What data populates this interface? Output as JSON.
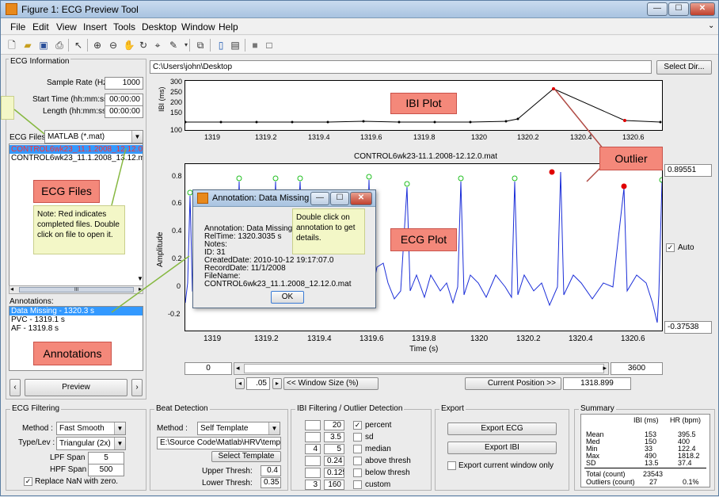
{
  "window": {
    "title": "Figure 1: ECG Preview Tool"
  },
  "menu": [
    "File",
    "Edit",
    "View",
    "Insert",
    "Tools",
    "Desktop",
    "Window",
    "Help"
  ],
  "ecg_info": {
    "title": "ECG Information",
    "sample_rate_label": "Sample Rate (Hz):",
    "sample_rate": "1000",
    "start_time_label": "Start Time (hh:mm:ss):",
    "start_time": "00:00:00",
    "length_label": "Length (hh:mm:ss):",
    "length": "00:00:00",
    "files_label": "ECG Files:",
    "file_type": "MATLAB (*.mat)",
    "files": [
      "CONTROL6wk23_11.1.2008_12.12.0.m",
      "CONTROL6wk23_11.1.2008_13.12.m"
    ],
    "scroll_glyph": "III"
  },
  "annotations": {
    "label": "Annotations:",
    "items": [
      "Data Missing - 1320.3 s",
      "PVC - 1319.1 s",
      "AF - 1319.8 s"
    ]
  },
  "preview_button": "Preview",
  "path": {
    "value": "C:\\Users\\john\\Desktop",
    "select_label": "Select Dir..."
  },
  "callouts": {
    "ibi": "IBI Plot",
    "ecg": "ECG Plot",
    "outlier": "Outlier",
    "files": "ECG Files",
    "annotations": "Annotations",
    "note": "Note: Red indicates completed files. Double click on file to open it.",
    "dblclick": "Double click on annotation to get details."
  },
  "ibi_plot": {
    "ylabel": "IBI (ms)",
    "yticks": [
      "300",
      "250",
      "200",
      "150",
      "100"
    ],
    "xticks": [
      "1319",
      "1319.2",
      "1319.4",
      "1319.6",
      "1319.8",
      "1320",
      "1320.2",
      "1320.4",
      "1320.6"
    ]
  },
  "ecg_plot": {
    "title": "CONTROL6wk23-11.1.2008-12.12.0.mat",
    "ylabel": "Amplitude",
    "xlabel": "Time (s)",
    "yticks": [
      "0.8",
      "0.6",
      "0.4",
      "0.2",
      "0",
      "-0.2"
    ],
    "xticks": [
      "1319",
      "1319.2",
      "1319.4",
      "1319.6",
      "1319.8",
      "1320",
      "1320.2",
      "1320.4",
      "1320.6"
    ],
    "ymax": "0.89551",
    "ymin": "-0.37538",
    "auto_label": "Auto"
  },
  "window_ctrl": {
    "start": "0",
    "end": "3600",
    "size": ".05",
    "size_label": "<< Window Size (%)",
    "pos_label": "Current Position >>",
    "pos": "1318.899"
  },
  "dialog": {
    "title": "Annotation: Data Missing",
    "lines": [
      "Annotation:  Data Missing",
      "RelTime:  1320.3035 s",
      "Notes:",
      "ID:  31",
      "CreatedDate:  2010-10-12 19:17:07.0",
      "RecordDate:  11/1/2008",
      "FileName:  CONTROL6wk23_11.1.2008_12.12.0.mat"
    ],
    "ok": "OK"
  },
  "ecg_filtering": {
    "title": "ECG Filtering",
    "method_label": "Method :",
    "method": "Fast Smooth",
    "type_label": "Type/Lev :",
    "type": "Triangular (2x)",
    "lpf_label": "LPF Span :",
    "lpf": "5",
    "hpf_label": "HPF Span :",
    "hpf": "500",
    "replace_label": "Replace NaN with zero."
  },
  "beat_detection": {
    "title": "Beat Detection",
    "method_label": "Method :",
    "method": "Self Template",
    "path": "E:\\Source Code\\Matlab\\HRV\\templates\\",
    "select_label": "Select Template",
    "upper_label": "Upper Thresh:",
    "upper": "0.4",
    "lower_label": "Lower Thresh:",
    "lower": "0.35"
  },
  "ibi_filter": {
    "title": "IBI Filtering / Outlier Detection",
    "rows": [
      {
        "a": "",
        "b": "20",
        "label": "percent",
        "checked": true
      },
      {
        "a": "",
        "b": "3.5",
        "label": "sd",
        "checked": false
      },
      {
        "a": "4",
        "b": "5",
        "label": "median",
        "checked": false
      },
      {
        "a": "",
        "b": "0.24",
        "label": "above thresh",
        "checked": false
      },
      {
        "a": "",
        "b": "0.125",
        "label": "below thresh",
        "checked": false
      },
      {
        "a": "3",
        "b": "160",
        "label": "custom",
        "checked": false
      }
    ]
  },
  "export": {
    "title": "Export",
    "ecg": "Export ECG",
    "ibi": "Export IBI",
    "current": "Export current window only"
  },
  "summary": {
    "title": "Summary",
    "col1": "IBI (ms)",
    "col2": "HR (bpm)",
    "rows": [
      {
        "k": "Mean",
        "a": "153",
        "b": "395.5"
      },
      {
        "k": "Med",
        "a": "150",
        "b": "400"
      },
      {
        "k": "Min",
        "a": "33",
        "b": "122.4"
      },
      {
        "k": "Max",
        "a": "490",
        "b": "1818.2"
      },
      {
        "k": "SD",
        "a": "13.5",
        "b": "37.4"
      }
    ],
    "total_label": "Total (count)",
    "total": "23543",
    "outliers_label": "Outliers (count)",
    "outliers": "27",
    "outliers_pct": "0.1%"
  }
}
